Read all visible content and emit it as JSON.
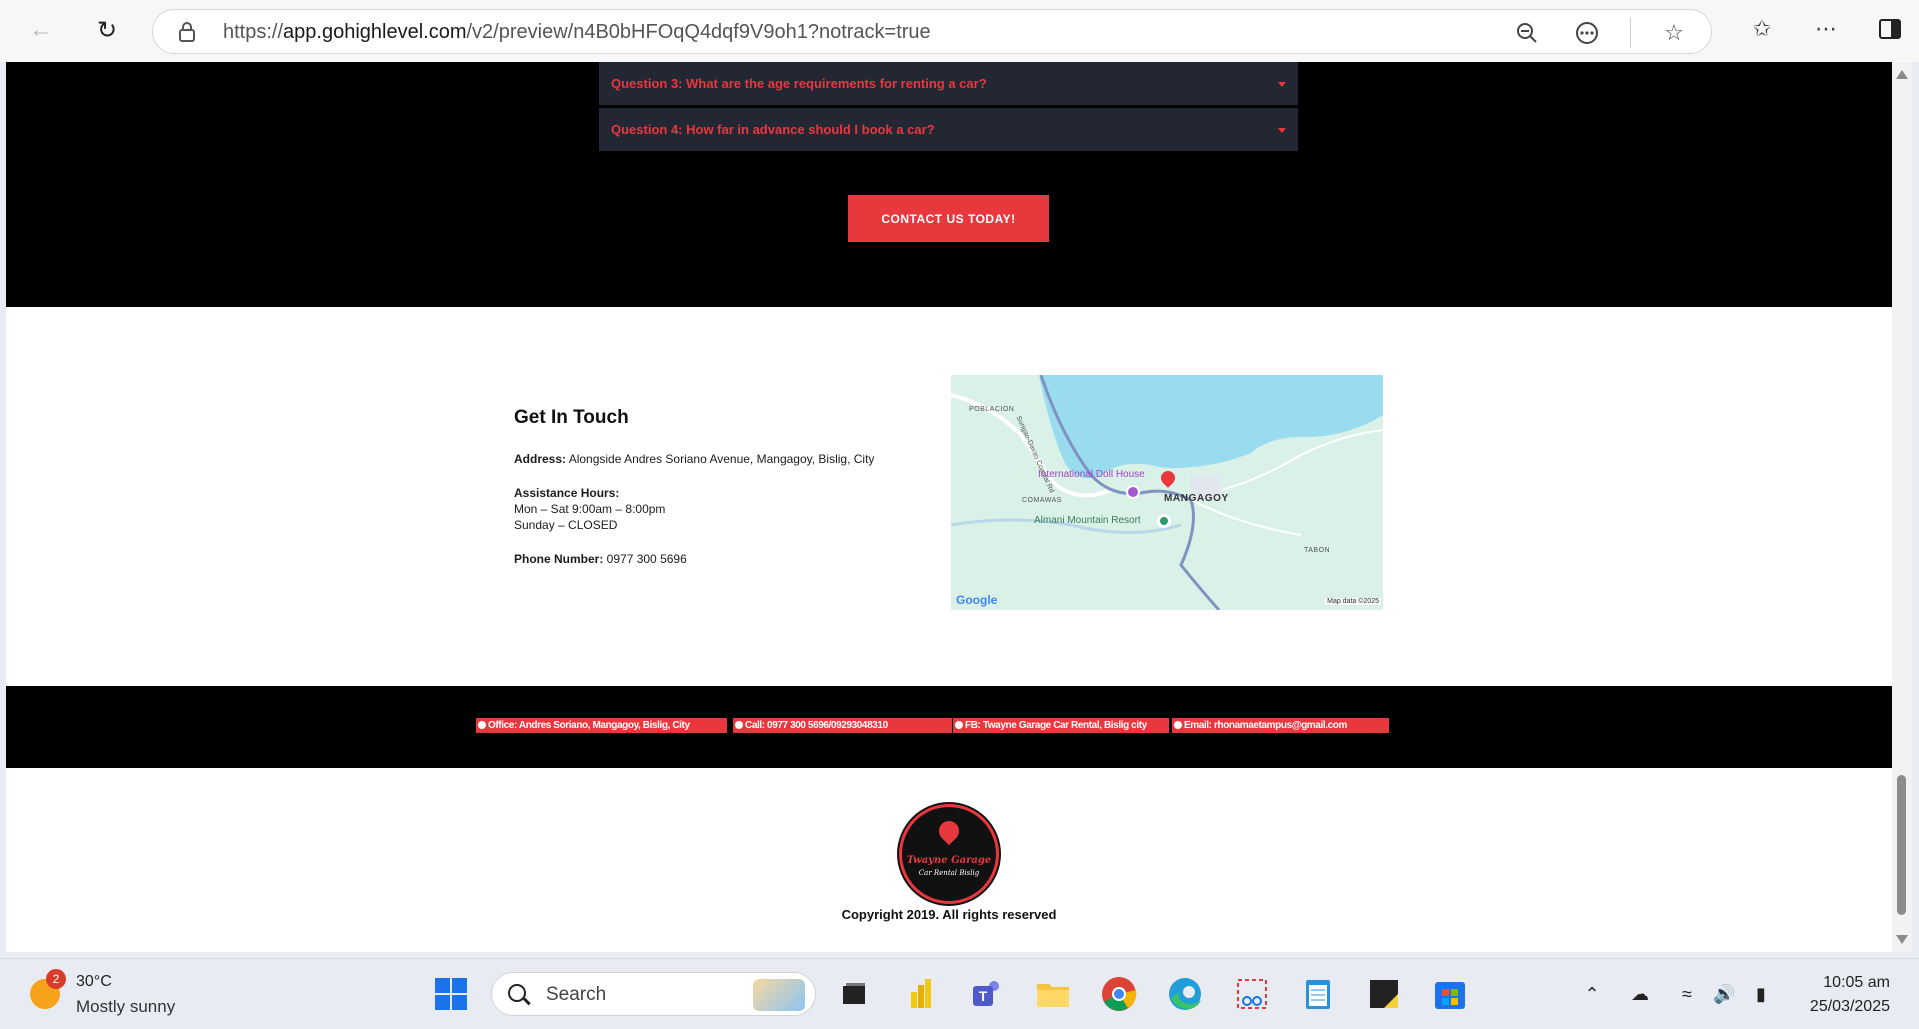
{
  "browser": {
    "url_prefix": "https://",
    "url_domain": "app.gohighlevel.com",
    "url_path": "/v2/preview/n4B0bHFOqQ4dqf9V9oh1?notrack=true"
  },
  "faq": {
    "items": [
      {
        "label": "Question 3: What are the age requirements for renting a car?"
      },
      {
        "label": "Question 4: How far in advance should I book a car?"
      }
    ],
    "cta_label": "CONTACT US TODAY!"
  },
  "contact": {
    "title": "Get In Touch",
    "address_label": "Address:",
    "address_value": " Alongside Andres Soriano Avenue, Mangagoy, Bislig, City",
    "hours_label": "Assistance Hours:",
    "hours_weekday": "Mon – Sat 9:00am – 8:00pm",
    "hours_sunday": "Sunday – CLOSED",
    "phone_label": "Phone Number:",
    "phone_value": " 0977 300 5696"
  },
  "map": {
    "labels": {
      "poblacion": "POBLACION",
      "road": "Surigao-Davao Coastal Rd",
      "doll_house": "International Doll House",
      "mangagoy": "MANGAGOY",
      "comawas": "COMAWAS",
      "resort": "Almani Mountain Resort",
      "tabon": "TABON",
      "google": "Google",
      "map_data": "Map data ©2025"
    },
    "colors": {
      "water": "#9adcef",
      "land": "#d6f0e4",
      "road": "#7f93c2",
      "pin": "#e8383e"
    }
  },
  "footer": {
    "office": "Office: Andres Soriano, Mangagoy, Bislig, City",
    "call": "Call: 0977 300 5696/09293048310",
    "fb": "FB: Twayne Garage Car Rental, Bislig city",
    "email": "Email: rhonamaetampus@gmail.com"
  },
  "brand": {
    "logo_title": "Twayne Garage",
    "logo_subtitle": "Car Rental Bislig",
    "copyright": "Copyright 2019. All rights reserved",
    "accent": "#e8383e"
  },
  "taskbar": {
    "weather_badge": "2",
    "temperature": "30°C",
    "condition": "Mostly sunny",
    "search_label": "Search",
    "time": "10:05 am",
    "date": "25/03/2025"
  }
}
